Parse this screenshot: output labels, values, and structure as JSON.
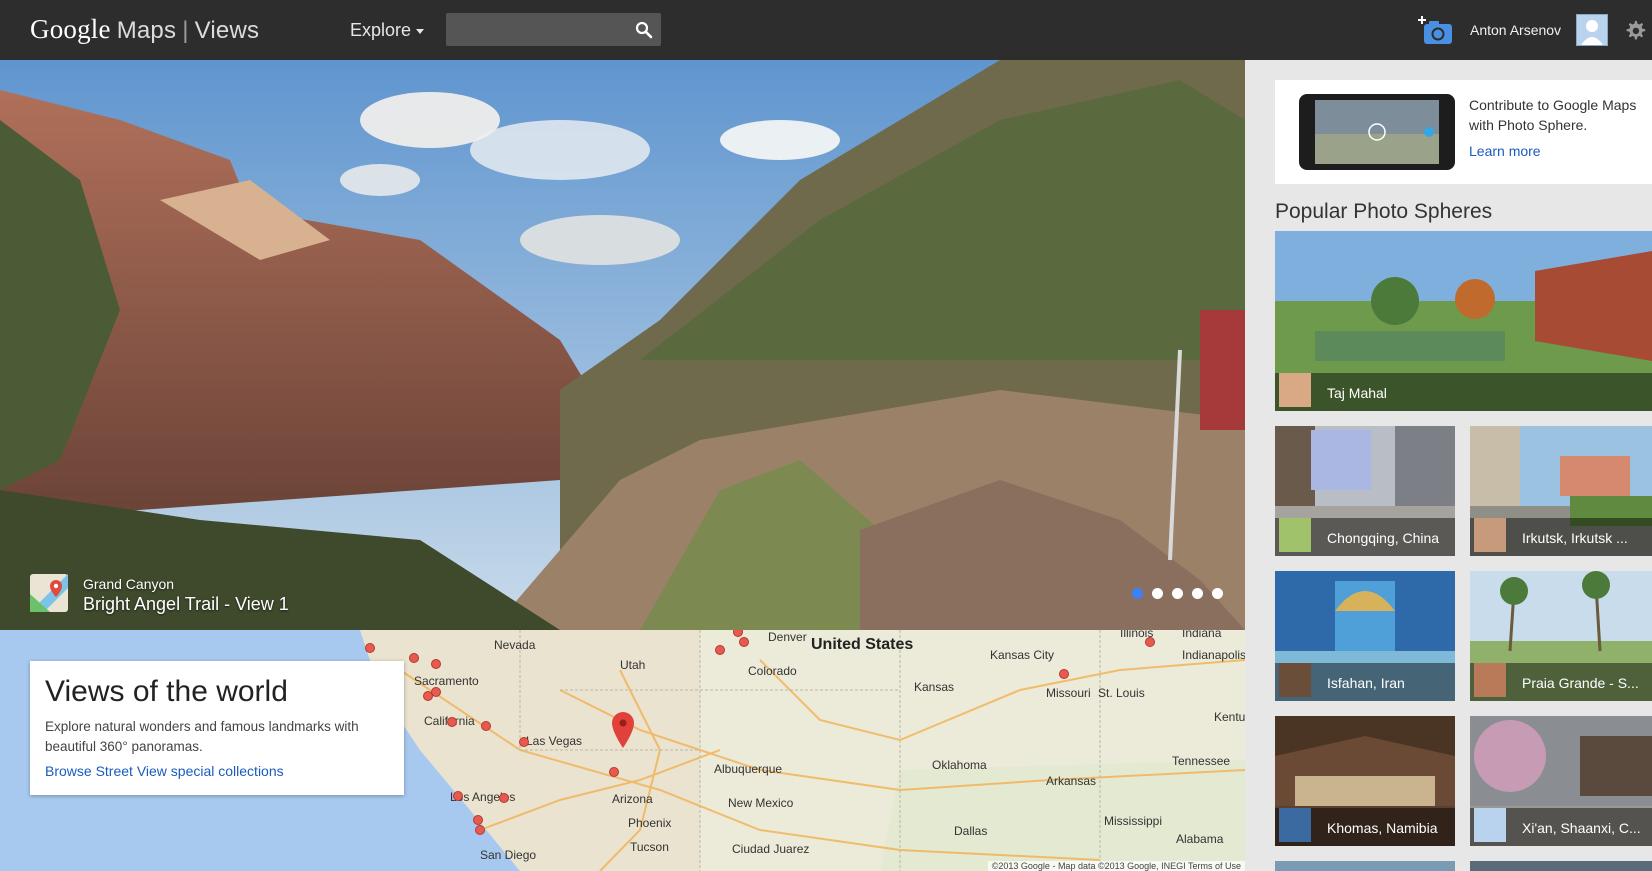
{
  "header": {
    "brand_google": "Google",
    "brand_maps": "Maps",
    "brand_separator": "|",
    "brand_views": "Views",
    "explore_label": "Explore",
    "search_value": "",
    "search_placeholder": "",
    "user_name": "Anton Arsenov"
  },
  "hero": {
    "subtitle": "Grand Canyon",
    "title": "Bright Angel Trail - View 1",
    "slide_count": 5,
    "active_slide": 1
  },
  "map": {
    "labels": {
      "nevada": "Nevada",
      "utah": "Utah",
      "sacramento": "Sacramento",
      "california": "California",
      "las_vegas": "Las Vegas",
      "los_angeles": "Los Angeles",
      "san_diego": "San Diego",
      "arizona": "Arizona",
      "phoenix": "Phoenix",
      "tucson": "Tucson",
      "denver": "Denver",
      "colorado": "Colorado",
      "united_states": "United States",
      "albuquerque": "Albuquerque",
      "new_mexico": "New Mexico",
      "ciudad_juarez": "Ciudad Juarez",
      "kansas_city": "Kansas City",
      "kansas": "Kansas",
      "missouri": "Missouri",
      "st_louis": "St. Louis",
      "oklahoma": "Oklahoma",
      "arkansas": "Arkansas",
      "tennessee": "Tennessee",
      "mississippi": "Mississippi",
      "alabama": "Alabama",
      "dallas": "Dallas",
      "illinois": "Illinois",
      "indiana": "Indiana",
      "indianapolis": "Indianapolis",
      "kentucky": "Kentu"
    },
    "attribution": "©2013 Google - Map data ©2013 Google, INEGI     Terms of Use"
  },
  "info_card": {
    "title": "Views of the world",
    "description": "Explore natural wonders and famous landmarks with beautiful 360° panoramas.",
    "link": "Browse Street View special collections"
  },
  "sidebar": {
    "promo_text": "Contribute to Google Maps with Photo Sphere.",
    "promo_link": "Learn more",
    "section_title": "Popular Photo Spheres",
    "tiles": [
      {
        "label": "Taj Mahal"
      },
      {
        "label": "Chongqing, China"
      },
      {
        "label": "Irkutsk, Irkutsk ..."
      },
      {
        "label": "Isfahan, Iran"
      },
      {
        "label": "Praia Grande - S..."
      },
      {
        "label": "Khomas, Namibia"
      },
      {
        "label": "Xi'an, Shaanxi, C..."
      }
    ]
  },
  "colors": {
    "topbar_bg": "#2d2d2d",
    "link_blue": "#1a5bbf",
    "active_dot": "#3b82f6",
    "map_marker": "#e0413b"
  }
}
